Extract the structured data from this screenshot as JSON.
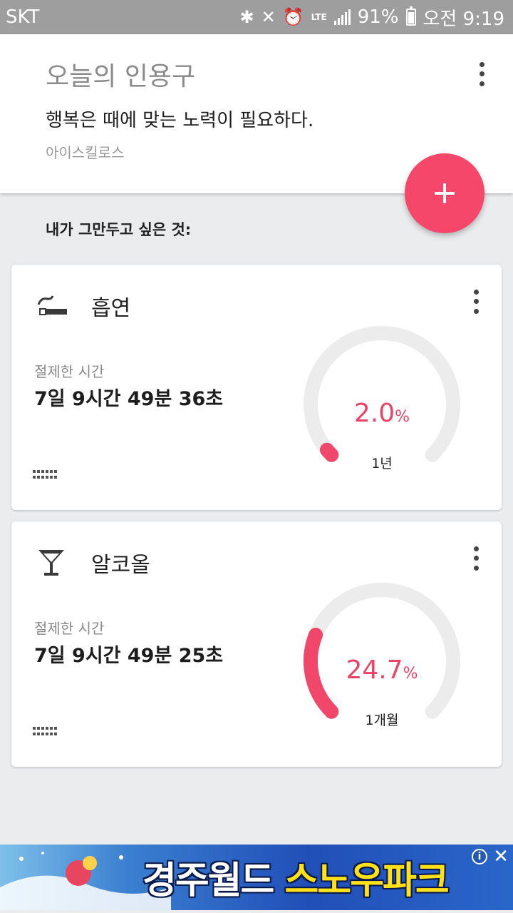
{
  "status_bar": {
    "carrier": "SKT",
    "network": "LTE",
    "battery": "91%",
    "time": "오전 9:19",
    "icons": [
      "bluetooth-icon",
      "mute-icon",
      "alarm-icon",
      "lte-icon",
      "signal-icon",
      "battery-icon"
    ]
  },
  "quote": {
    "title": "오늘의 인용구",
    "text": "행복은 때에 맞는 노력이 필요하다.",
    "author": "아이스킬로스"
  },
  "section_label": "내가 그만두고 싶은 것:",
  "colors": {
    "accent": "#f4476a",
    "gauge_track": "#ececec",
    "gauge_progress": "#f0476b",
    "percent_text": "#e94366"
  },
  "habits": [
    {
      "name": "흡연",
      "icon": "cigarette-icon",
      "abstinence_label": "절제한 시간",
      "abstinence_value": "7일 9시간 49분 36초",
      "progress_percent": 2.0,
      "percent_number": "2.0",
      "percent_unit": "%",
      "goal_period": "1년"
    },
    {
      "name": "알코올",
      "icon": "cocktail-glass-icon",
      "abstinence_label": "절제한 시간",
      "abstinence_value": "7일 9시간 49분 25초",
      "progress_percent": 24.7,
      "percent_number": "24.7",
      "percent_unit": "%",
      "goal_period": "1개월"
    }
  ],
  "ad": {
    "text_white": "경주월드 ",
    "text_yellow": "스노우파크",
    "info_label": "i",
    "close_label": "✕"
  }
}
